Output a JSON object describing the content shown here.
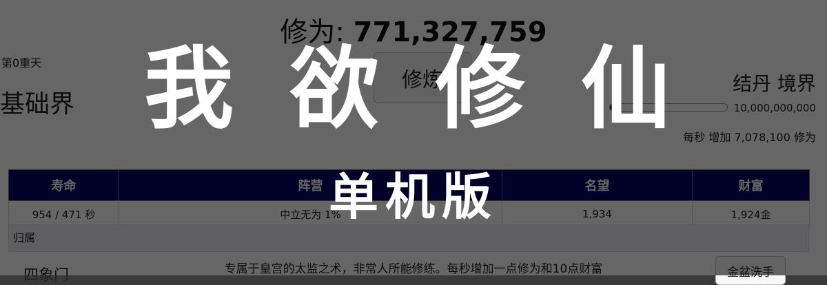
{
  "header": {
    "xiuwei_label": "修为:",
    "xiuwei_value": "771,327,759",
    "day_label": "第0重天",
    "realm_left": "基础界",
    "cultivate_button": "修炼",
    "realm_right": "结丹 境界",
    "progress_target": "10,000,000,000",
    "progress_fraction": 0.077,
    "rate_text": "每秒 增加 7,078,100 修为"
  },
  "table": {
    "columns": [
      "寿命",
      "阵营",
      "名望",
      "财富"
    ],
    "row": [
      "954 / 471 秒",
      "中立无为 1%",
      "1,934",
      "1,924金"
    ]
  },
  "section": {
    "label": "归属",
    "name": "四象门",
    "description": "专属于皇宫的太监之术，非常人所能修练。每秒增加一点修为和10点财富",
    "button": "金盆洗手"
  },
  "banner": {
    "title": "我 欲 修 仙",
    "subtitle": "单机版"
  },
  "colors": {
    "header_bg": "#000066",
    "progress": "#1f4f9a",
    "overlay": "rgba(0,0,0,0.6)"
  }
}
